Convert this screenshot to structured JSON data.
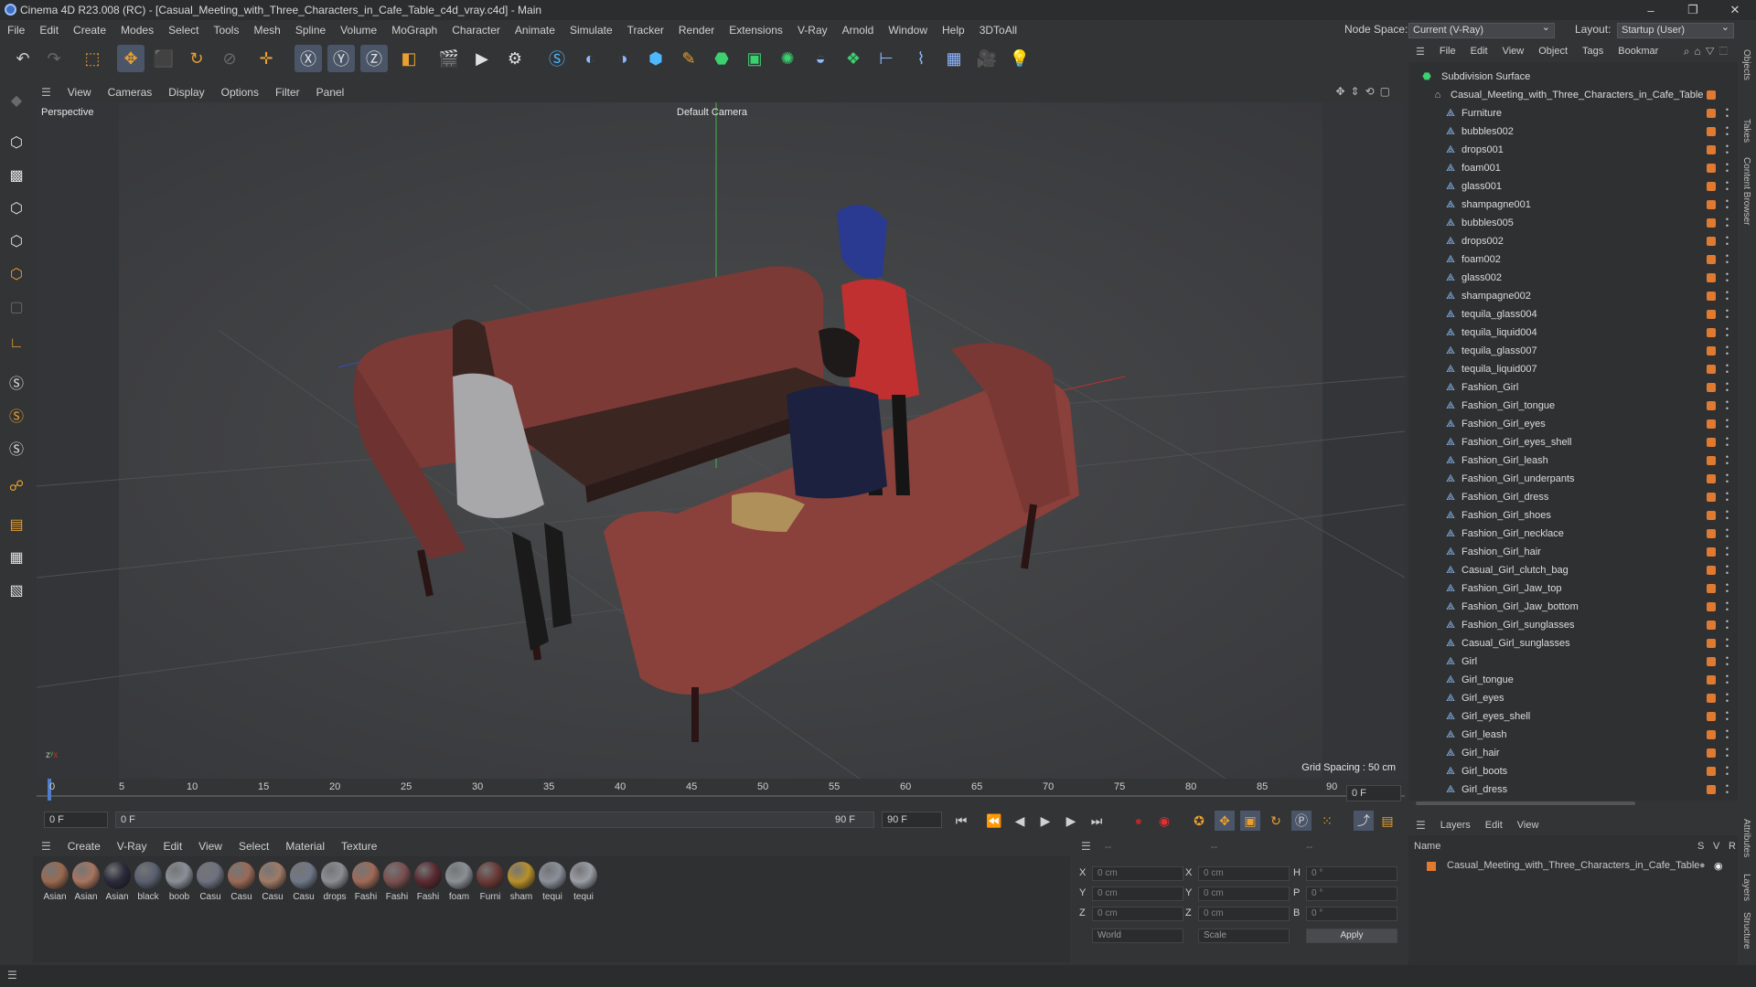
{
  "window": {
    "title": "Cinema 4D R23.008 (RC) - [Casual_Meeting_with_Three_Characters_in_Cafe_Table_c4d_vray.c4d] - Main",
    "controls": [
      "–",
      "❐",
      "✕"
    ]
  },
  "menu": [
    "File",
    "Edit",
    "Create",
    "Modes",
    "Select",
    "Tools",
    "Mesh",
    "Spline",
    "Volume",
    "MoGraph",
    "Character",
    "Animate",
    "Simulate",
    "Tracker",
    "Render",
    "Extensions",
    "V-Ray",
    "Arnold",
    "Window",
    "Help",
    "3DToAll"
  ],
  "node_space": {
    "label": "Node Space:",
    "value": "Current (V-Ray)"
  },
  "layout": {
    "label": "Layout:",
    "value": "Startup (User)"
  },
  "viewport": {
    "menu": [
      "View",
      "Cameras",
      "Display",
      "Options",
      "Filter",
      "Panel"
    ],
    "view_name": "Perspective",
    "camera": "Default Camera",
    "grid_spacing": "Grid Spacing : 50 cm"
  },
  "timeline": {
    "ticks": [
      "0",
      "5",
      "10",
      "15",
      "20",
      "25",
      "30",
      "35",
      "40",
      "45",
      "50",
      "55",
      "60",
      "65",
      "70",
      "75",
      "80",
      "85",
      "90"
    ],
    "current_frame": "0 F",
    "start_field": "0 F",
    "slider_start": "0 F",
    "slider_end": "90 F",
    "end_field": "90 F"
  },
  "material_manager": {
    "menu": [
      "Create",
      "V-Ray",
      "Edit",
      "View",
      "Select",
      "Material",
      "Texture"
    ],
    "materials": [
      {
        "name": "Asian",
        "color": "#9a6a50"
      },
      {
        "name": "Asian",
        "color": "#a87560"
      },
      {
        "name": "Asian",
        "color": "#2a2a3a"
      },
      {
        "name": "black",
        "color": "#5a6070"
      },
      {
        "name": "boob",
        "color": "#8a8f98"
      },
      {
        "name": "Casu",
        "color": "#6e7280"
      },
      {
        "name": "Casu",
        "color": "#9a6a58"
      },
      {
        "name": "Casu",
        "color": "#a07a66"
      },
      {
        "name": "Casu",
        "color": "#707888"
      },
      {
        "name": "drops",
        "color": "#8a8e94"
      },
      {
        "name": "Fashi",
        "color": "#a06a58"
      },
      {
        "name": "Fashi",
        "color": "#7a5050"
      },
      {
        "name": "Fashi",
        "color": "#5a2a30"
      },
      {
        "name": "foam",
        "color": "#8a9096"
      },
      {
        "name": "Furni",
        "color": "#6a3a36"
      },
      {
        "name": "sham",
        "color": "#b8902a"
      },
      {
        "name": "tequi",
        "color": "#8a909a"
      },
      {
        "name": "tequi",
        "color": "#9a9ea6"
      }
    ]
  },
  "attributes": {
    "rows": [
      {
        "a": "X",
        "av": "0 cm",
        "b": "X",
        "bv": "0 cm",
        "c": "H",
        "cv": "0 °"
      },
      {
        "a": "Y",
        "av": "0 cm",
        "b": "Y",
        "bv": "0 cm",
        "c": "P",
        "cv": "0 °"
      },
      {
        "a": "Z",
        "av": "0 cm",
        "b": "Z",
        "bv": "0 cm",
        "c": "B",
        "cv": "0 °"
      }
    ],
    "dash1": "--",
    "dash2": "--",
    "dash3": "--",
    "coord_mode": "World",
    "scale_mode": "Scale",
    "apply": "Apply"
  },
  "objects": {
    "menu": [
      "File",
      "Edit",
      "View",
      "Object",
      "Tags",
      "Bookmar"
    ],
    "root": "Subdivision Surface",
    "scene": "Casual_Meeting_with_Three_Characters_in_Cafe_Table",
    "items": [
      "Furniture",
      "bubbles002",
      "drops001",
      "foam001",
      "glass001",
      "shampagne001",
      "bubbles005",
      "drops002",
      "foam002",
      "glass002",
      "shampagne002",
      "tequila_glass004",
      "tequila_liquid004",
      "tequila_glass007",
      "tequila_liquid007",
      "Fashion_Girl",
      "Fashion_Girl_tongue",
      "Fashion_Girl_eyes",
      "Fashion_Girl_eyes_shell",
      "Fashion_Girl_leash",
      "Fashion_Girl_underpants",
      "Fashion_Girl_dress",
      "Fashion_Girl_shoes",
      "Fashion_Girl_necklace",
      "Fashion_Girl_hair",
      "Casual_Girl_clutch_bag",
      "Fashion_Girl_Jaw_top",
      "Fashion_Girl_Jaw_bottom",
      "Fashion_Girl_sunglasses",
      "Casual_Girl_sunglasses",
      "Girl",
      "Girl_tongue",
      "Girl_eyes",
      "Girl_eyes_shell",
      "Girl_leash",
      "Girl_hair",
      "Girl_boots",
      "Girl_dress"
    ]
  },
  "layers": {
    "menu": [
      "Layers",
      "Edit",
      "View"
    ],
    "header": {
      "name": "Name",
      "s": "S",
      "v": "V",
      "r": "R"
    },
    "items": [
      "Casual_Meeting_with_Three_Characters_in_Cafe_Table"
    ]
  },
  "side_tabs": [
    "Objects",
    "Takes",
    "Content Browser",
    "Attributes",
    "Layers",
    "Structure"
  ]
}
